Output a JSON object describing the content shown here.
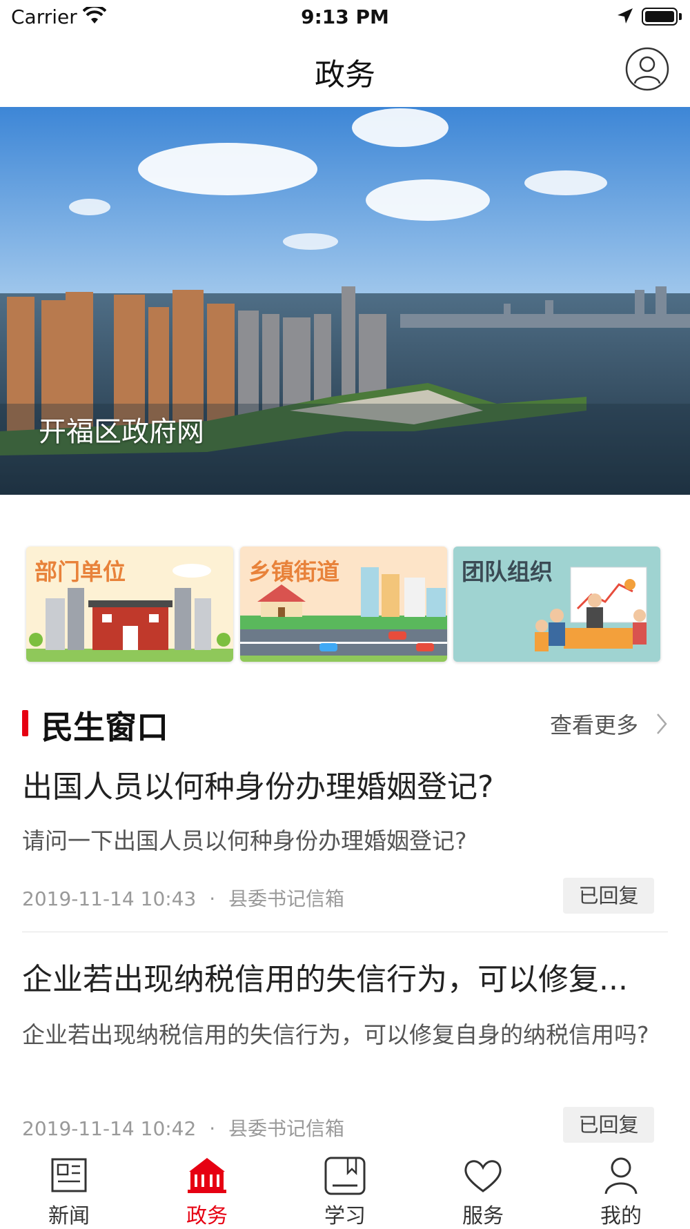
{
  "status_bar": {
    "carrier": "Carrier",
    "time": "9:13 PM"
  },
  "nav": {
    "title": "政务"
  },
  "banner": {
    "caption": "开福区政府网"
  },
  "categories": [
    {
      "label": "部门单位"
    },
    {
      "label": "乡镇街道"
    },
    {
      "label": "团队组织"
    }
  ],
  "section": {
    "title": "民生窗口",
    "more_label": "查看更多"
  },
  "articles": [
    {
      "title": "出国人员以何种身份办理婚姻登记?",
      "summary": "请问一下出国人员以何种身份办理婚姻登记?",
      "datetime": "2019-11-14 10:43",
      "separator": "·",
      "source": "县委书记信箱",
      "status": "已回复"
    },
    {
      "title": "企业若出现纳税信用的失信行为，可以修复...",
      "summary": "企业若出现纳税信用的失信行为，可以修复自身的纳税信用吗?",
      "datetime": "2019-11-14 10:42",
      "separator": "·",
      "source": "县委书记信箱",
      "status": "已回复"
    }
  ],
  "tabs": [
    {
      "label": "新闻",
      "icon": "newspaper-icon"
    },
    {
      "label": "政务",
      "icon": "government-building-icon",
      "active": true
    },
    {
      "label": "学习",
      "icon": "book-icon"
    },
    {
      "label": "服务",
      "icon": "heart-icon"
    },
    {
      "label": "我的",
      "icon": "person-icon"
    }
  ],
  "colors": {
    "accent": "#e60012",
    "text": "#222222",
    "muted": "#999999"
  }
}
